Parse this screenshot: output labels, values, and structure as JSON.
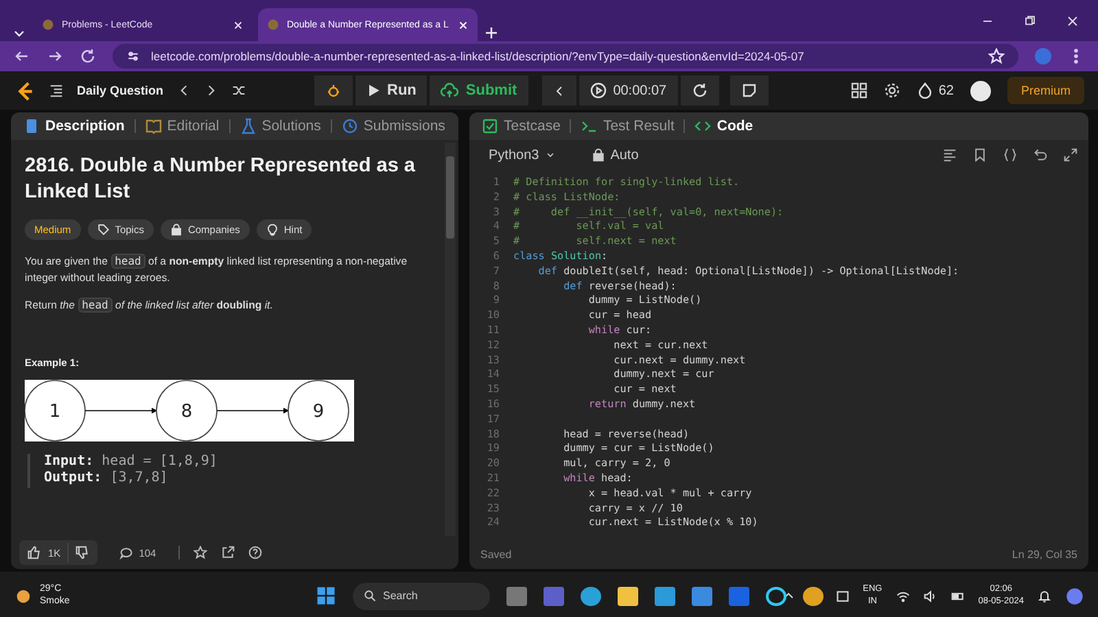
{
  "browser": {
    "tabs": [
      {
        "title": "Problems - LeetCode",
        "selected": false
      },
      {
        "title": "Double a Number Represented as a L",
        "selected": true
      }
    ],
    "url": "leetcode.com/problems/double-a-number-represented-as-a-linked-list/description/?envType=daily-question&envId=2024-05-07"
  },
  "nav": {
    "title": "Daily Question",
    "run": "Run",
    "submit": "Submit",
    "timer": "00:00:07",
    "streak": "62",
    "premium": "Premium"
  },
  "description_panel": {
    "tabs": [
      {
        "kind": "description",
        "label": "Description",
        "selected": true
      },
      {
        "kind": "editorial",
        "label": "Editorial",
        "selected": false
      },
      {
        "kind": "solutions",
        "label": "Solutions",
        "selected": false
      },
      {
        "kind": "submissions",
        "label": "Submissions",
        "selected": false
      }
    ],
    "title": "2816. Double a Number Represented as a Linked List",
    "tags": [
      {
        "kind": "difficulty",
        "label": "Medium"
      },
      {
        "kind": "topics",
        "label": "Topics"
      },
      {
        "kind": "companies",
        "label": "Companies"
      },
      {
        "kind": "hint",
        "label": "Hint"
      }
    ],
    "paragraphs": [
      {
        "segments": [
          {
            "kind": "text",
            "text": "You are given the "
          },
          {
            "kind": "code",
            "text": "head"
          },
          {
            "kind": "text",
            "text": " of a **non-empty** linked list representing a non-negative integer without leading zeroes."
          }
        ]
      },
      {
        "segments": [
          {
            "kind": "text",
            "text": "Return *the* "
          },
          {
            "kind": "code",
            "text": "head"
          },
          {
            "kind": "text",
            "text": " *of the linked list after* **doubling** *it.*"
          }
        ]
      }
    ],
    "example_heading": "Example 1:",
    "diagram_nodes": [
      "1",
      "8",
      "9"
    ],
    "example_lines": [
      {
        "label": "Input:",
        "value": "head = [1,8,9]"
      },
      {
        "label": "Output:",
        "value": "[3,7,8]"
      }
    ],
    "likes": "1K",
    "comments": "104"
  },
  "code_panel": {
    "tabs": [
      {
        "kind": "testcase",
        "label": "Testcase",
        "selected": false
      },
      {
        "kind": "result",
        "label": "Test Result",
        "selected": false
      },
      {
        "kind": "code",
        "label": "Code",
        "selected": true
      }
    ],
    "language": "Python3",
    "mode": "Auto",
    "lines": [
      {
        "n": "1",
        "segments": [
          {
            "kind": "comment",
            "text": "# Definition for singly-linked list."
          }
        ]
      },
      {
        "n": "2",
        "segments": [
          {
            "kind": "comment",
            "text": "# class ListNode:"
          }
        ]
      },
      {
        "n": "3",
        "segments": [
          {
            "kind": "comment",
            "text": "#     def __init__(self, val=0, next=None):"
          }
        ]
      },
      {
        "n": "4",
        "segments": [
          {
            "kind": "comment",
            "text": "#         self.val = val"
          }
        ]
      },
      {
        "n": "5",
        "segments": [
          {
            "kind": "comment",
            "text": "#         self.next = next"
          }
        ]
      },
      {
        "n": "6",
        "segments": [
          {
            "kind": "keyword",
            "text": "class "
          },
          {
            "kind": "type",
            "text": "Solution"
          },
          {
            "kind": "plain",
            "text": ":"
          }
        ]
      },
      {
        "n": "7",
        "segments": [
          {
            "kind": "keyword",
            "text": "    def "
          },
          {
            "kind": "plain",
            "text": "doubleIt(self, head: Optional[ListNode]) -> Optional[ListNode]:"
          }
        ]
      },
      {
        "n": "8",
        "segments": [
          {
            "kind": "keyword",
            "text": "        def "
          },
          {
            "kind": "plain",
            "text": "reverse(head):"
          }
        ]
      },
      {
        "n": "9",
        "segments": [
          {
            "kind": "plain",
            "text": "            dummy = ListNode()"
          }
        ]
      },
      {
        "n": "10",
        "segments": [
          {
            "kind": "plain",
            "text": "            cur = head"
          }
        ]
      },
      {
        "n": "11",
        "segments": [
          {
            "kind": "control",
            "text": "            while "
          },
          {
            "kind": "plain",
            "text": "cur:"
          }
        ]
      },
      {
        "n": "12",
        "segments": [
          {
            "kind": "plain",
            "text": "                next = cur.next"
          }
        ]
      },
      {
        "n": "13",
        "segments": [
          {
            "kind": "plain",
            "text": "                cur.next = dummy.next"
          }
        ]
      },
      {
        "n": "14",
        "segments": [
          {
            "kind": "plain",
            "text": "                dummy.next = cur"
          }
        ]
      },
      {
        "n": "15",
        "segments": [
          {
            "kind": "plain",
            "text": "                cur = next"
          }
        ]
      },
      {
        "n": "16",
        "segments": [
          {
            "kind": "control",
            "text": "            return "
          },
          {
            "kind": "plain",
            "text": "dummy.next"
          }
        ]
      },
      {
        "n": "17"
      },
      {
        "n": "18",
        "segments": [
          {
            "kind": "plain",
            "text": "        head = reverse(head)"
          }
        ]
      },
      {
        "n": "19",
        "segments": [
          {
            "kind": "plain",
            "text": "        dummy = cur = ListNode()"
          }
        ]
      },
      {
        "n": "20",
        "segments": [
          {
            "kind": "plain",
            "text": "        mul, carry = 2, 0"
          }
        ]
      },
      {
        "n": "21",
        "segments": [
          {
            "kind": "control",
            "text": "        while "
          },
          {
            "kind": "plain",
            "text": "head:"
          }
        ]
      },
      {
        "n": "22",
        "segments": [
          {
            "kind": "plain",
            "text": "            x = head.val * mul + carry"
          }
        ]
      },
      {
        "n": "23",
        "segments": [
          {
            "kind": "plain",
            "text": "            carry = x // 10"
          }
        ]
      },
      {
        "n": "24",
        "segments": [
          {
            "kind": "plain",
            "text": "            cur.next = ListNode(x % 10)"
          }
        ]
      }
    ],
    "status": "Saved",
    "cursor": "Ln 29, Col 35"
  },
  "taskbar": {
    "temperature": "29°C",
    "weather": "Smoke",
    "search": "Search",
    "language": "ENG",
    "region": "IN",
    "time": "02:06",
    "date": "08-05-2024"
  }
}
